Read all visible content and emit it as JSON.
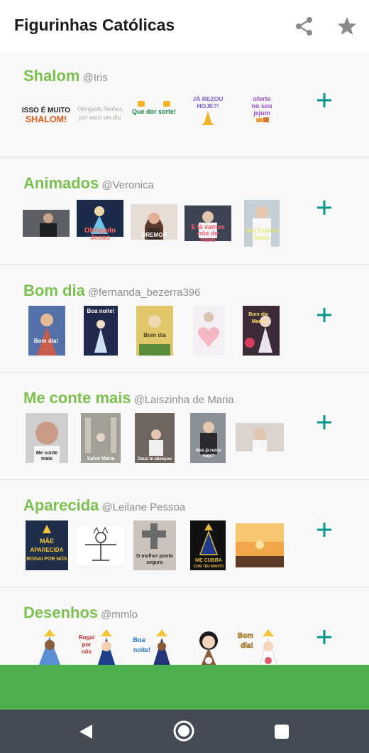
{
  "app": {
    "title": "Figurinhas Católicas",
    "accent": "#7cc04f",
    "add_color": "#009688",
    "bottom_bar_color": "#4caf50"
  },
  "toolbar": {
    "share_icon": "share-icon",
    "star_icon": "star-icon"
  },
  "packs": [
    {
      "name": "Shalom",
      "author": "@Iris",
      "stickers": [
        {
          "text1": "ISSO É MUITO",
          "text2": "SHALOM!"
        },
        {
          "text1": "Obrigado Senhor,",
          "text2": "por mais um dia"
        },
        {
          "text1": "Que dor sorte!"
        },
        {
          "text1": "JÁ REZOU",
          "text2": "HOJE?!"
        },
        {
          "text1": "oferte",
          "text2": "no seu",
          "text3": "jejum"
        }
      ]
    },
    {
      "name": "Animados",
      "author": "@Veronica",
      "stickers": [
        {},
        {
          "text1": "Obrigado",
          "text2": "Jesus"
        },
        {
          "text1": "OREMOS"
        },
        {
          "text1": "E lá vamos",
          "text2": "nós de",
          "text3": "novo"
        },
        {
          "text1": "Vem Espírito",
          "text2": "Santo"
        }
      ]
    },
    {
      "name": "Bom dia",
      "author": "@fernanda_bezerra396",
      "stickers": [
        {
          "text1": "Bom dia!"
        },
        {
          "text1": "Boa noite!"
        },
        {
          "text1": "Bom dia"
        },
        {},
        {
          "text1": "Bom dia",
          "text2": "Maria"
        }
      ]
    },
    {
      "name": "Me conte mais",
      "author": "@Laiszinha de Maria",
      "stickers": [
        {
          "text1": "Me conte",
          "text2": "mais"
        },
        {
          "text1": "Salve Maria"
        },
        {
          "text1": "Deus te abençoe"
        },
        {
          "text1": "Mas já rezou",
          "text2": "hoje?"
        },
        {}
      ]
    },
    {
      "name": "Aparecida",
      "author": "@Leilane Pessoa",
      "stickers": [
        {
          "text1": "MÃE",
          "text2": "APARECIDA",
          "text3": "ROGAI POR NÓS"
        },
        {},
        {
          "text1": "O melhor ponto",
          "text2": "seguro"
        },
        {
          "text1": "ME CUBRA",
          "text2": "COM TEU MANTO"
        },
        {}
      ]
    },
    {
      "name": "Desenhos",
      "author": "@mmlo",
      "stickers": [
        {},
        {
          "text1": "Rogai",
          "text2": "por",
          "text3": "nós"
        },
        {
          "text1": "Boa",
          "text2": "noite!"
        },
        {},
        {
          "text1": "Bom",
          "text2": "dia!"
        }
      ]
    }
  ],
  "nav": {
    "back_icon": "back-triangle-icon",
    "home_icon": "home-circle-icon",
    "recent_icon": "recent-apps-icon"
  }
}
